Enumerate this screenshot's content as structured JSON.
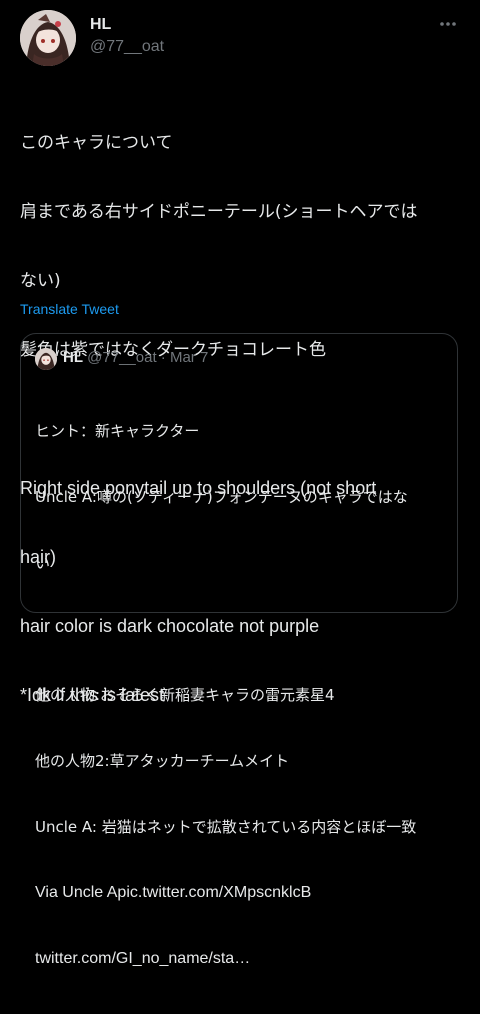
{
  "tweet": {
    "author_name": "HL",
    "author_handle": "@77__oat",
    "more_icon": "more-horizontal-icon",
    "body_lines": [
      "このキャラについて",
      "肩まである右サイドポニーテール(ショートヘアでは",
      "ない)",
      "髪色は紫ではなくダークチョコレート色",
      "",
      "Right side ponytail up to shoulders (not short",
      "hair)",
      "hair color is dark chocolate not purple",
      "*Idk if this is latest"
    ],
    "translate_label": "Translate Tweet"
  },
  "quoted_tweet": {
    "author_name": "HL",
    "author_handle": "@77__oat",
    "separator": "·",
    "date": "Mar 7",
    "body_lines": [
      "ヒント：新キャラクター",
      "Uncle A:噂の(ソティーナ)フォンテーヌのキャラではな",
      "い",
      "",
      "他の人物:おそらく新稲妻キャラの雷元素星4",
      "他の人物2:草アタッカーチームメイト",
      "Uncle A: 岩猫はネットで拡散されている内容とほぼ一致",
      "Via Uncle Apic.twitter.com/XMpscnklcB",
      "twitter.com/GI_no_name/sta…"
    ]
  },
  "colors": {
    "background": "#000000",
    "text": "#e7e9ea",
    "secondary": "#71767b",
    "link": "#1d9bf0",
    "border": "#2f3336"
  }
}
